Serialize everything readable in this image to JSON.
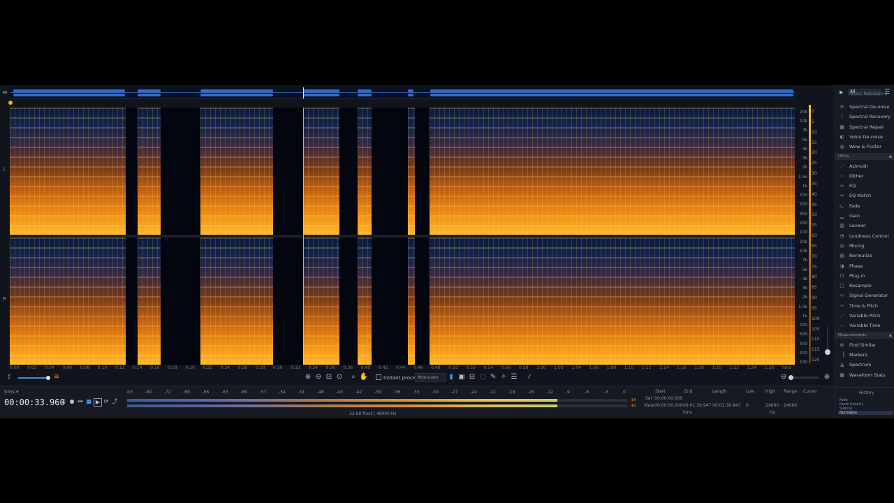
{
  "app": {
    "overview_marker": "⇹"
  },
  "channels": {
    "left": "L",
    "right": "R"
  },
  "freq_labels": [
    "20k",
    "10k",
    "7k",
    "5k",
    "4k",
    "3k",
    "2k",
    "1.5k",
    "1k",
    "700",
    "500",
    "300",
    "200",
    "100"
  ],
  "db_labels": [
    "0",
    "5",
    "10",
    "15",
    "20",
    "25",
    "30",
    "35",
    "40",
    "45",
    "50",
    "55",
    "60",
    "65",
    "70",
    "75",
    "80",
    "85",
    "90",
    "95",
    "100",
    "105",
    "110",
    "115",
    "120"
  ],
  "time_ruler": [
    "0:00",
    "0:02",
    "0:04",
    "0:06",
    "0:08",
    "0:10",
    "0:12",
    "0:14",
    "0:16",
    "0:18",
    "0:20",
    "0:22",
    "0:24",
    "0:26",
    "0:28",
    "0:30",
    "0:32",
    "0:34",
    "0:36",
    "0:38",
    "0:40",
    "0:42",
    "0:44",
    "0:46",
    "0:48",
    "0:50",
    "0:52",
    "0:54",
    "0:56",
    "0:58",
    "1:00",
    "1:02",
    "1:04",
    "1:06",
    "1:08",
    "1:10",
    "1:12",
    "1:14",
    "1:16",
    "1:18",
    "1:20",
    "1:22",
    "1:24",
    "1:26",
    "hms"
  ],
  "toolbar": {
    "instant_process": "Instant process",
    "attenuate": "Attenuate"
  },
  "transport": {
    "filename": "hms ▾",
    "timecode": "00:00:33.960"
  },
  "meter": {
    "scale": [
      "-Inf.",
      "-80",
      "-72",
      "-69",
      "-66",
      "-63",
      "-60",
      "-57",
      "-54",
      "-51",
      "-48",
      "-45",
      "-42",
      "-39",
      "-36",
      "-33",
      "-30",
      "-27",
      "-24",
      "-21",
      "-18",
      "-15",
      "-12",
      "-9",
      "-6",
      "-3",
      "0"
    ],
    "peak_l": "-14",
    "peak_r": "-16",
    "level_fraction": 0.86,
    "format": "32-bit float | 48000 Hz"
  },
  "selection": {
    "headers": [
      "Start",
      "End",
      "Length",
      "Low",
      "High",
      "Range",
      "Cursor"
    ],
    "sel_label": "Sel",
    "view_label": "View",
    "sel_start": "00:00:00.000",
    "view_start": "00:00:00.000",
    "view_end": "00:01:30.947",
    "view_length": "00:01:30.947",
    "low": "0",
    "high": "24000",
    "range": "24000",
    "unit_time": "hms",
    "unit_freq": "Hz"
  },
  "modules": {
    "filter": "All",
    "partial_top": "Music Rebalance",
    "repair": [
      "Spectral De-noise",
      "Spectral Recovery",
      "Spectral Repair",
      "Voice De-noise",
      "Wow & Flutter"
    ],
    "utility_label": "Utility",
    "utility": [
      "Azimuth",
      "Dither",
      "EQ",
      "EQ Match",
      "Fade",
      "Gain",
      "Leveler",
      "Loudness Control",
      "Mixing",
      "Normalize",
      "Phase",
      "Plug-in",
      "Resample",
      "Signal Generator",
      "Time & Pitch",
      "Variable Pitch",
      "Variable Time"
    ],
    "measurements_label": "Measurements",
    "measurements": [
      "Find Similar",
      "Markers",
      "Spectrum",
      "Waveform Stats"
    ]
  },
  "history": {
    "title": "History",
    "items": [
      "Fade",
      "Paste (Insert)",
      "Silence",
      "Normalize"
    ]
  },
  "colors": {
    "accent": "#3d8bf0",
    "spectro_hot": "#f39a18",
    "spectro_cold": "#0b1a3a"
  }
}
